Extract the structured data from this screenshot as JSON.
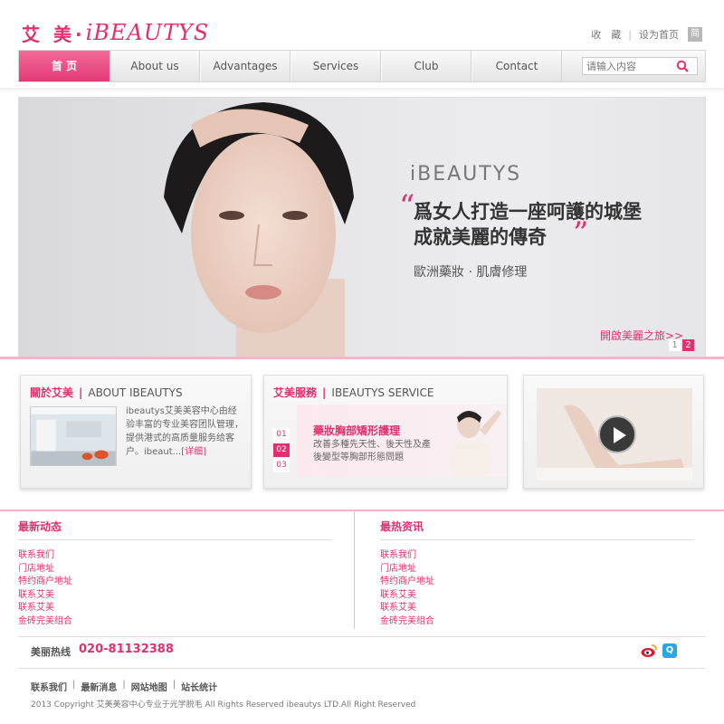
{
  "header": {
    "logo_cn": "艾 美·",
    "logo_en": "iBEAUTYS",
    "links": [
      "收　藏",
      "设为首页"
    ],
    "lang": "简"
  },
  "nav": {
    "items": [
      "首 页",
      "About us",
      "Advantages",
      "Services",
      "Club",
      "Contact"
    ],
    "active_index": 0,
    "search_placeholder": "请输入内容"
  },
  "banner": {
    "brand": "iBEAUTYS",
    "quote_open": "“",
    "quote_close": "”",
    "slogan_line1": "爲女人打造一座呵護的城堡",
    "slogan_line2": "成就美麗的傳奇",
    "sub_slogan": "歐洲藥妝 · 肌膚修理",
    "link": "開啟美麗之旅>>",
    "pages": [
      "1",
      "2"
    ],
    "active_page": 2
  },
  "about": {
    "title_cn": "關於艾美",
    "title_en": "ABOUT IBEAUTYS",
    "text": "ibeautys艾美美容中心由经验丰富的专业美容团队管理，提供港式的高质量服务给客户。ibeaut...",
    "more": "[详细]"
  },
  "services": {
    "title_cn": "艾美服務",
    "title_en": "IBEAUTYS SERVICE",
    "tabs": [
      "01",
      "02",
      "03"
    ],
    "active_tab": 1,
    "item_title": "藥妝胸部矯形護理",
    "item_desc": "改善多種先天性、後天性及產後變型等胸部形態問題"
  },
  "news": {
    "left_title": "最新动态",
    "left_items": [
      "联系我们",
      "门店地址",
      "特约商户地址",
      "联系艾美",
      "联系艾美",
      "金砖完美组合"
    ],
    "right_title": "最热资讯",
    "right_items": [
      "联系我们",
      "门店地址",
      "特约商户地址",
      "联系艾美",
      "联系艾美",
      "金砖完美组合"
    ]
  },
  "footer": {
    "hotline_label": "美丽热线",
    "hotline_number": "020-81132388",
    "qq_label": "Q",
    "links": [
      "联系我们",
      "最新消息",
      "网站地图",
      "站长统计"
    ],
    "copyright": "2013 Copyright 艾美美容中心专业于光学脱毛 All Rights Reserved ibeautys LTD.All Right Reserved"
  },
  "colors": {
    "accent": "#e0306e",
    "nav_bg": "#e8e8e8"
  }
}
